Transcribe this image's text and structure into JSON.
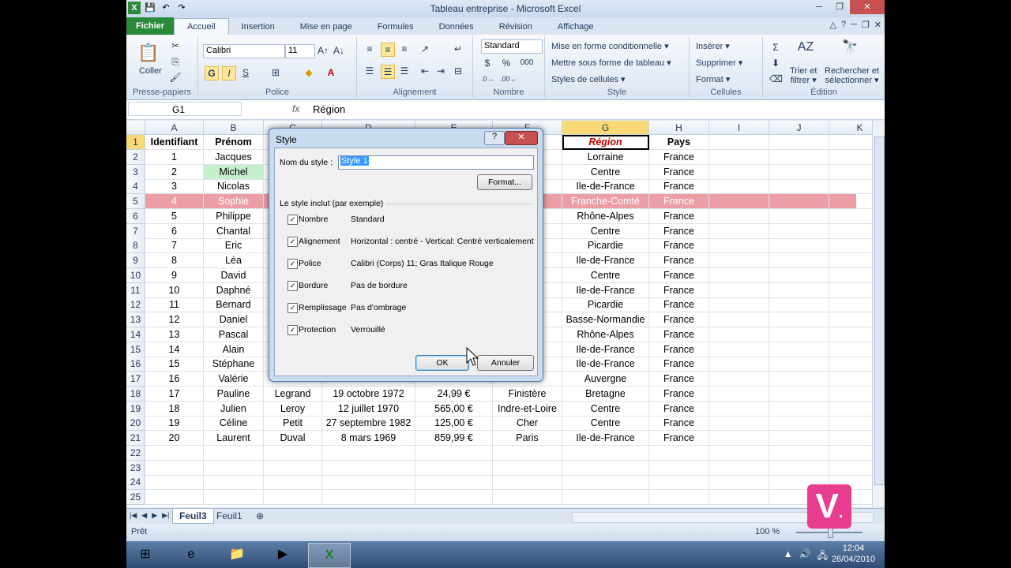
{
  "window": {
    "title": "Tableau entreprise - Microsoft Excel",
    "close_label": "✕",
    "minimize_label": "─",
    "restore_label": "❐"
  },
  "ribbon_tabs": [
    "Fichier",
    "Accueil",
    "Insertion",
    "Mise en page",
    "Formules",
    "Données",
    "Révision",
    "Affichage"
  ],
  "ribbon": {
    "clipboard": {
      "paste": "Coller",
      "group": "Presse-papiers"
    },
    "font": {
      "name": "Calibri",
      "size": "11",
      "bold": "G",
      "italic": "I",
      "underline": "S",
      "group": "Police"
    },
    "alignment": {
      "group": "Alignement"
    },
    "number": {
      "format": "Standard",
      "percent": "%",
      "thousands": "000",
      "group": "Nombre"
    },
    "style": {
      "conditional": "Mise en forme conditionnelle ▾",
      "as_table": "Mettre sous forme de tableau ▾",
      "cell_styles": "Styles de cellules ▾",
      "group": "Style"
    },
    "cells": {
      "insert": "Insérer ▾",
      "delete": "Supprimer ▾",
      "format": "Format ▾",
      "group": "Cellules"
    },
    "editing": {
      "sort": "Trier et filtrer ▾",
      "sort_l1": "Trier et",
      "sort_l2": "filtrer ▾",
      "find_l1": "Rechercher et",
      "find_l2": "sélectionner ▾",
      "group": "Édition"
    }
  },
  "formula_bar": {
    "name_box": "G1",
    "fx": "fx",
    "value": "Région"
  },
  "columns": [
    "A",
    "B",
    "C",
    "D",
    "E",
    "F",
    "G",
    "H",
    "I",
    "J",
    "K"
  ],
  "rows": [
    [
      "Identifiant",
      "Prénom",
      "",
      "",
      "",
      "ent",
      "Région",
      "Pays"
    ],
    [
      "1",
      "Jacques",
      "",
      "",
      "",
      "",
      "Lorraine",
      "France"
    ],
    [
      "2",
      "Michel",
      "",
      "",
      "",
      "",
      "Centre",
      "France"
    ],
    [
      "3",
      "Nicolas",
      "",
      "",
      "",
      "",
      "Ile-de-France",
      "France"
    ],
    [
      "4",
      "Sophie",
      "",
      "",
      "",
      "",
      "Franche-Comté",
      "France"
    ],
    [
      "5",
      "Philippe",
      "",
      "",
      "",
      "",
      "Rhône-Alpes",
      "France"
    ],
    [
      "6",
      "Chantal",
      "",
      "",
      "",
      "ire",
      "Centre",
      "France"
    ],
    [
      "7",
      "Eric",
      "",
      "",
      "",
      "",
      "Picardie",
      "France"
    ],
    [
      "8",
      "Léa",
      "",
      "",
      "",
      "",
      "Ile-de-France",
      "France"
    ],
    [
      "9",
      "David",
      "",
      "",
      "",
      "",
      "Centre",
      "France"
    ],
    [
      "10",
      "Daphné",
      "",
      "",
      "",
      "",
      "Ile-de-France",
      "France"
    ],
    [
      "11",
      "Bernard",
      "",
      "",
      "",
      "",
      "Picardie",
      "France"
    ],
    [
      "12",
      "Daniel",
      "",
      "",
      "",
      "",
      "Basse-Normandie",
      "France"
    ],
    [
      "13",
      "Pascal",
      "",
      "",
      "",
      "",
      "Rhône-Alpes",
      "France"
    ],
    [
      "14",
      "Alain",
      "",
      "",
      "",
      "",
      "Ile-de-France",
      "France"
    ],
    [
      "15",
      "Stéphane",
      "",
      "",
      "",
      "",
      "Ile-de-France",
      "France"
    ],
    [
      "16",
      "Valérie",
      "",
      "",
      "",
      "",
      "Auvergne",
      "France"
    ],
    [
      "17",
      "Pauline",
      "Legrand",
      "19 octobre 1972",
      "24,99 €",
      "Finistère",
      "Bretagne",
      "France"
    ],
    [
      "18",
      "Julien",
      "Leroy",
      "12 juillet 1970",
      "565,00 €",
      "Indre-et-Loire",
      "Centre",
      "France"
    ],
    [
      "19",
      "Céline",
      "Petit",
      "27 septembre 1982",
      "125,00 €",
      "Cher",
      "Centre",
      "France"
    ],
    [
      "20",
      "Laurent",
      "Duval",
      "8 mars 1969",
      "859,99 €",
      "Paris",
      "Ile-de-France",
      "France"
    ],
    [
      "",
      "",
      "",
      "",
      "",
      "",
      "",
      ""
    ],
    [
      "",
      "",
      "",
      "",
      "",
      "",
      "",
      ""
    ],
    [
      "",
      "",
      "",
      "",
      "",
      "",
      "",
      ""
    ],
    [
      "",
      "",
      "",
      "",
      "",
      "",
      "",
      ""
    ]
  ],
  "sheets": [
    "Feuil3",
    "Feuil1"
  ],
  "status": {
    "ready": "Prêt",
    "zoom": "100 %"
  },
  "taskbar": {
    "time": "12:04",
    "date": "26/04/2010"
  },
  "dialog": {
    "title": "Style",
    "help": "?",
    "close": "✕",
    "name_label": "Nom du style :",
    "name_value": "Style 1",
    "format_button": "Format...",
    "includes_label": "Le style inclut (par exemple)",
    "options": [
      {
        "label": "Nombre",
        "value": "Standard"
      },
      {
        "label": "Alignement",
        "value": "Horizontal : centré - Vertical: Centré verticalement"
      },
      {
        "label": "Police",
        "value": "Calibri (Corps) 11; Gras Italique Rouge"
      },
      {
        "label": "Bordure",
        "value": "Pas de bordure"
      },
      {
        "label": "Remplissage",
        "value": "Pas d'ombrage"
      },
      {
        "label": "Protection",
        "value": "Verrouillé"
      }
    ],
    "ok": "OK",
    "cancel": "Annuler"
  },
  "colors": {
    "accent_file": "#2a8a3a",
    "highlight_row": "#ec9ea6",
    "selected_header": "#f9d976",
    "region_text": "#c00000"
  },
  "watermark": "V."
}
